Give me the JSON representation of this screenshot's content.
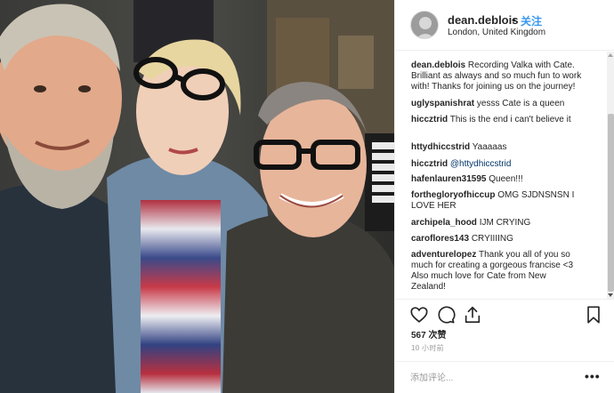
{
  "post": {
    "username": "dean.deblois",
    "dot": "•",
    "follow_label": "关注",
    "location": "London, United Kingdom",
    "likes": "567 次赞",
    "time": "10 小时前",
    "comment_placeholder": "添加评论...",
    "more": "•••"
  },
  "comments": [
    {
      "user": "dean.deblois",
      "lines": [
        "Recording Valka with Cate.",
        "Brilliant as always and so much fun to work",
        "with! Thanks for joining us on the journey!"
      ]
    },
    {
      "user": "uglyspanishrat",
      "lines": [
        "yesss Cate is a queen"
      ]
    },
    {
      "user": "hiccztrid",
      "lines": [
        "This is the end i can't believe it"
      ]
    },
    {
      "user": "httydhiccstrid",
      "lines": [
        "Yaaaaas"
      ]
    },
    {
      "user": "hiccztrid",
      "mention": "@httydhiccstrid",
      "lines": []
    },
    {
      "user": "hafenlauren31595",
      "lines": [
        "Queen!!!"
      ]
    },
    {
      "user": "forthegloryofhiccup",
      "lines": [
        "OMG SJDNSNSN I",
        "LOVE HER"
      ]
    },
    {
      "user": "archipela_hood",
      "lines": [
        "IJM CRYING"
      ]
    },
    {
      "user": "caroflores143",
      "lines": [
        "CRYIIIING"
      ]
    },
    {
      "user": "adventurelopez",
      "lines": [
        "Thank you all of you so",
        "much for creating a gorgeous francise <3",
        "Also much love for Cate from New",
        "Zealand!"
      ]
    }
  ],
  "icons": {
    "like": "heart-icon",
    "comment": "comment-bubble-icon",
    "share": "share-icon",
    "save": "bookmark-icon"
  },
  "colors": {
    "follow": "#3897f0",
    "mention": "#003569",
    "muted": "#999999",
    "border": "#efefef"
  }
}
